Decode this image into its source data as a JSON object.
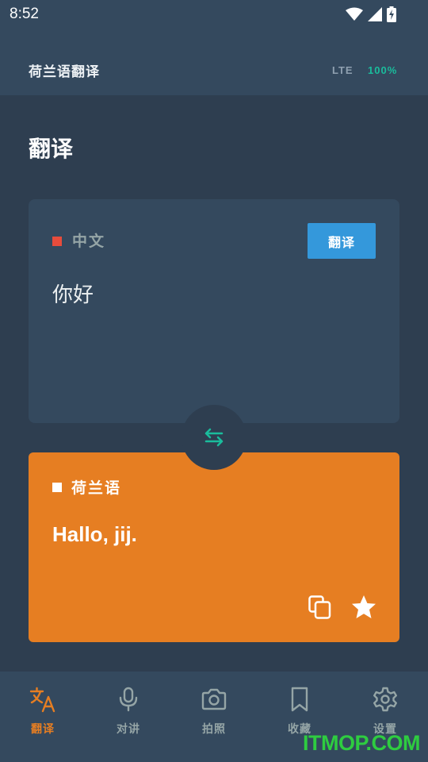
{
  "status_bar": {
    "time": "8:52"
  },
  "header": {
    "app_title": "荷兰语翻译",
    "network": "LTE",
    "battery": "100%"
  },
  "page": {
    "title": "翻译"
  },
  "source": {
    "language": "中文",
    "text": "你好",
    "translate_button": "翻译"
  },
  "target": {
    "language": "荷兰语",
    "text": "Hallo, jij."
  },
  "nav": {
    "items": [
      {
        "label": "翻译",
        "icon": "translate-icon",
        "active": true
      },
      {
        "label": "对讲",
        "icon": "microphone-icon",
        "active": false
      },
      {
        "label": "拍照",
        "icon": "camera-icon",
        "active": false
      },
      {
        "label": "收藏",
        "icon": "bookmark-icon",
        "active": false
      },
      {
        "label": "设置",
        "icon": "gear-icon",
        "active": false
      }
    ]
  },
  "watermark": "ITMOP.COM",
  "colors": {
    "background": "#2e3e50",
    "card": "#34495e",
    "accent_orange": "#e67e22",
    "accent_blue": "#3498db",
    "accent_teal": "#1abc9c",
    "source_marker": "#e74c3c"
  }
}
